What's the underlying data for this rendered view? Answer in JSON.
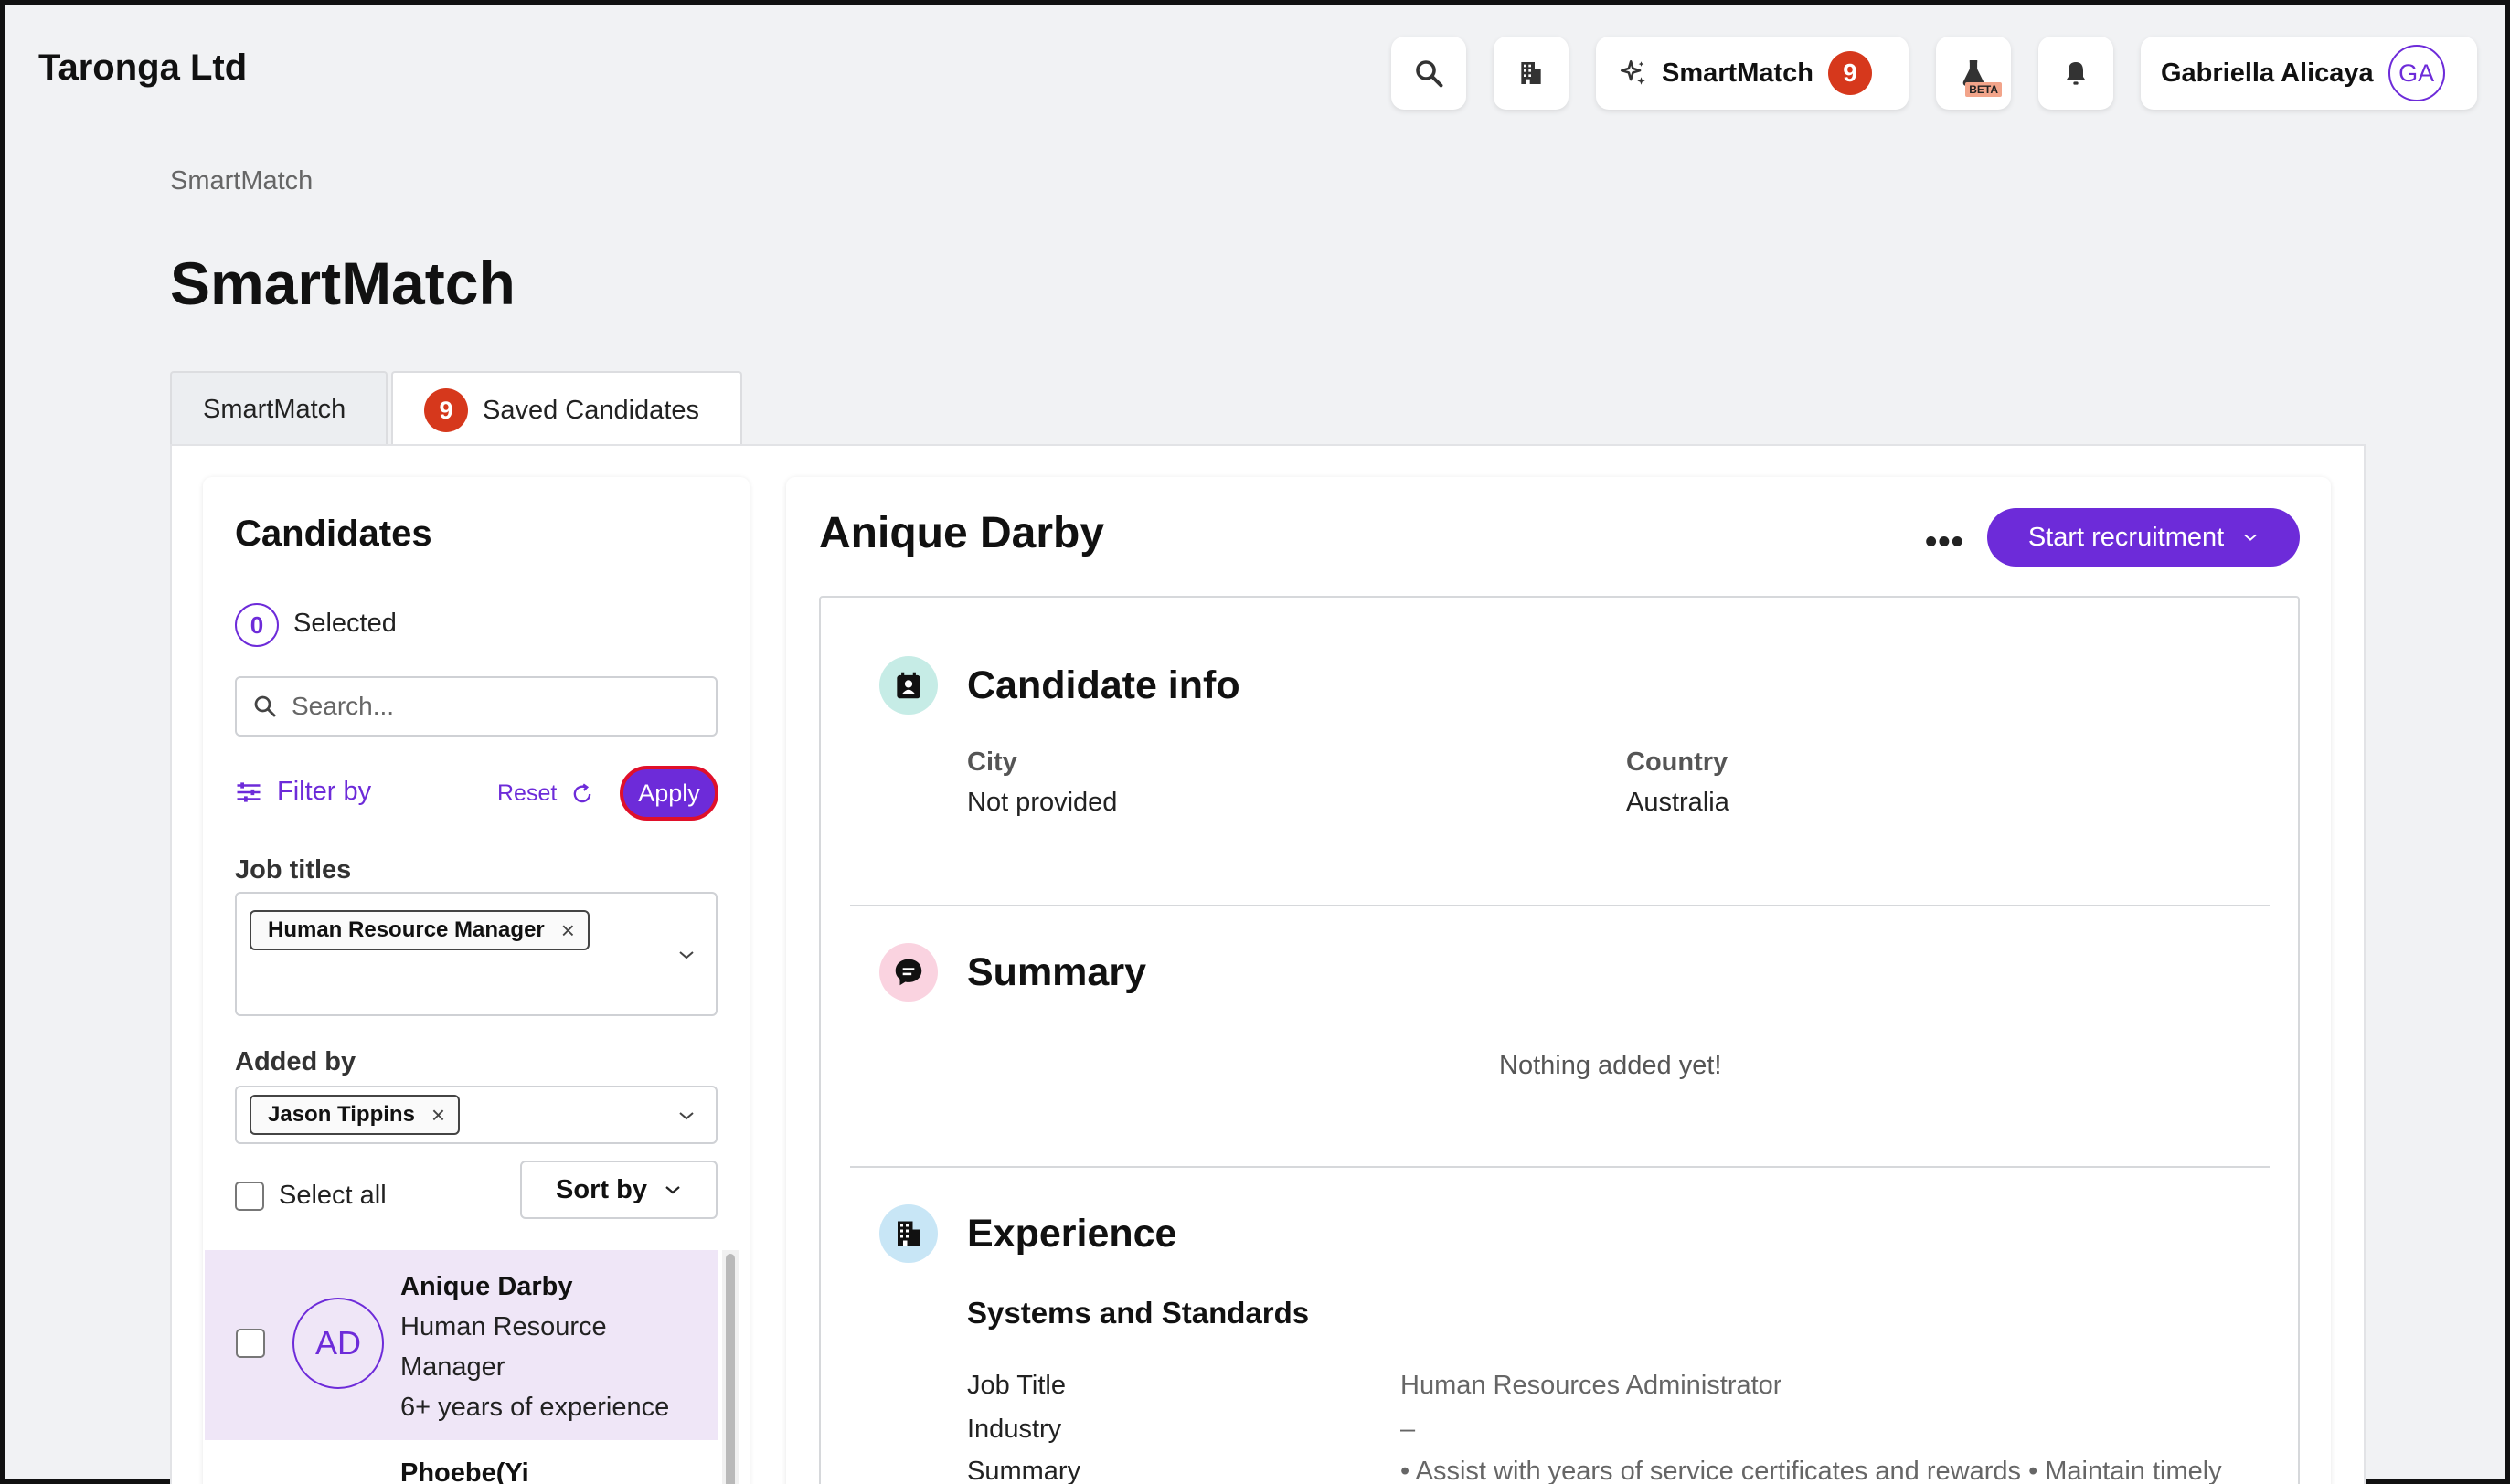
{
  "header": {
    "brand": "Taronga Ltd",
    "smartmatch_label": "SmartMatch",
    "smartmatch_count": "9",
    "beta_label": "BETA",
    "user_name": "Gabriella Alicaya",
    "user_initials": "GA"
  },
  "breadcrumb": "SmartMatch",
  "page_title": "SmartMatch",
  "tabs": [
    {
      "label": "SmartMatch"
    },
    {
      "label": "Saved Candidates",
      "count": "9"
    }
  ],
  "candidates_panel": {
    "title": "Candidates",
    "selected_count": "0",
    "selected_label": "Selected",
    "search_placeholder": "Search...",
    "filter_label": "Filter by",
    "reset_label": "Reset",
    "apply_label": "Apply",
    "job_titles_label": "Job titles",
    "job_titles_chips": [
      "Human Resource Manager"
    ],
    "added_by_label": "Added by",
    "added_by_chips": [
      "Jason Tippins"
    ],
    "select_all_label": "Select all",
    "sort_label": "Sort by",
    "list": [
      {
        "initials": "AD",
        "name": "Anique Darby",
        "role_line1": "Human Resource",
        "role_line2": "Manager",
        "experience": "6+ years of experience"
      },
      {
        "name": "Phoebe(Yi"
      }
    ]
  },
  "detail": {
    "name": "Anique Darby",
    "more_label": "•••",
    "start_label": "Start recruitment",
    "candidate_info": {
      "title": "Candidate info",
      "city_label": "City",
      "city_value": "Not provided",
      "country_label": "Country",
      "country_value": "Australia"
    },
    "summary": {
      "title": "Summary",
      "empty_text": "Nothing added yet!"
    },
    "experience": {
      "title": "Experience",
      "company": "Systems and Standards",
      "rows": [
        {
          "label": "Job Title",
          "value": "Human Resources Administrator"
        },
        {
          "label": "Industry",
          "value": "–"
        },
        {
          "label": "Summary",
          "value": "• Assist with years of service certificates and rewards • Maintain timely"
        }
      ]
    }
  },
  "colors": {
    "accent": "#6d2bd9",
    "badge": "#d6381c",
    "apply_outline": "#e0102a",
    "selected_row": "#efe6f7"
  }
}
